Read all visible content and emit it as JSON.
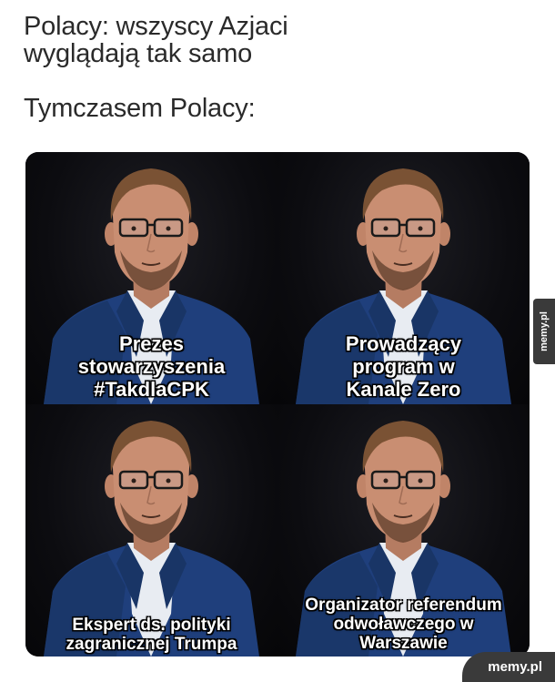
{
  "caption_top": "Polacy: wszyscy Azjaci\nwyglądają tak samo",
  "caption_bottom": "Tymczasem Polacy:",
  "tiles": [
    {
      "caption": "Prezes\nstowarzyszenia\n#TakdlaCPK"
    },
    {
      "caption": "Prowadzący\nprogram w\nKanale Zero"
    },
    {
      "caption": "Ekspert ds. polityki\nzagranicznej Trumpa"
    },
    {
      "caption": "Organizator referendum\nodwoławczego w\nWarszawie"
    }
  ],
  "watermark_side": "memy.pl",
  "watermark_corner": "memy.pl",
  "colors": {
    "background": "#ffffff",
    "caption_text": "#2a2a2a",
    "suit": "#1f3f7c",
    "shirt": "#e8ecf2",
    "skin": "#c98e72",
    "hair": "#7a5234",
    "beard": "#6a4632",
    "watermark_bg": "#3a3a3a"
  }
}
